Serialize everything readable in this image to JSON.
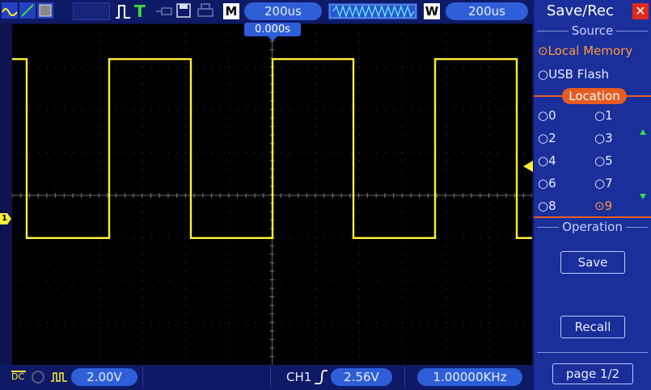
{
  "header": {
    "mode_label": "M",
    "timebase": "200us",
    "window_label": "W",
    "window_timebase": "200us"
  },
  "trigger_time_marker": "0.000s",
  "channel_marker": "1",
  "bottom": {
    "coupling": "DC",
    "ch1_volts_div": "2.00V",
    "trigger_source": "CH1",
    "trigger_level": "2.56V",
    "frequency": "1.00000KHz"
  },
  "panel": {
    "title": "Save/Rec",
    "source_title": "Source",
    "source_options": [
      {
        "label": "Local Memory",
        "selected": true
      },
      {
        "label": "USB Flash",
        "selected": false
      }
    ],
    "location_title": "Location",
    "locations": [
      {
        "label": "0",
        "selected": false
      },
      {
        "label": "1",
        "selected": false
      },
      {
        "label": "2",
        "selected": false
      },
      {
        "label": "3",
        "selected": false
      },
      {
        "label": "4",
        "selected": false
      },
      {
        "label": "5",
        "selected": false
      },
      {
        "label": "6",
        "selected": false
      },
      {
        "label": "7",
        "selected": false
      },
      {
        "label": "8",
        "selected": false
      },
      {
        "label": "9",
        "selected": true
      }
    ],
    "operation_title": "Operation",
    "save_label": "Save",
    "recall_label": "Recall",
    "page_label": "page 1/2"
  },
  "colors": {
    "trace": "#ffee33",
    "accent": "#e65c22",
    "panel_bg": "#1a2f9a",
    "pill": "#2e5fd8"
  },
  "waveform": {
    "type": "square",
    "frequency": "1.00000KHz",
    "high_level_div": 3.2,
    "low_level_div": -1.0
  }
}
